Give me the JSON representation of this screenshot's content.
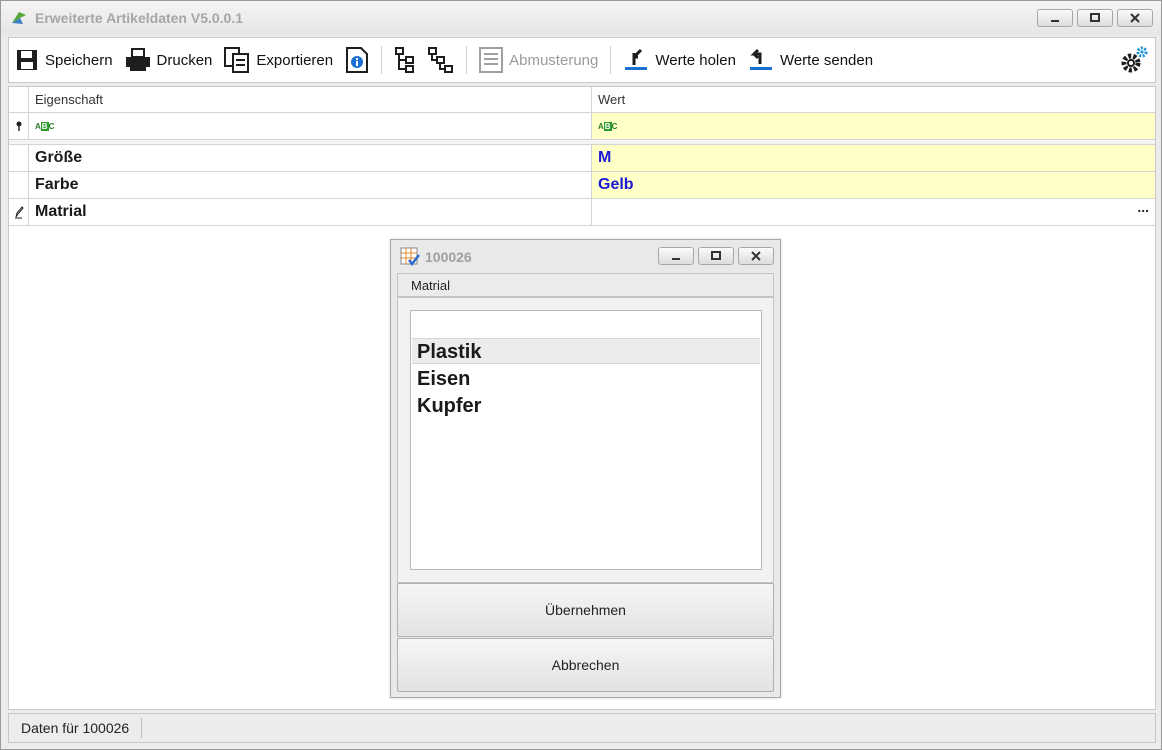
{
  "window": {
    "title": "Erweiterte Artikeldaten V5.0.0.1"
  },
  "toolbar": {
    "save_label": "Speichern",
    "print_label": "Drucken",
    "export_label": "Exportieren",
    "sampling_label": "Abmusterung",
    "fetch_label": "Werte holen",
    "send_label": "Werte senden"
  },
  "grid": {
    "columns": {
      "property": "Eigenschaft",
      "value": "Wert"
    },
    "filter_icon": "abc-filter-icon",
    "rows": [
      {
        "property": "Größe",
        "value": "M"
      },
      {
        "property": "Farbe",
        "value": "Gelb"
      },
      {
        "property": "Matrial",
        "value": "",
        "ellipsis": "..."
      }
    ]
  },
  "dialog": {
    "title": "100026",
    "field_label": "Matrial",
    "items": [
      "Plastik",
      "Eisen",
      "Kupfer"
    ],
    "selected_index": 0,
    "apply_label": "Übernehmen",
    "cancel_label": "Abbrechen"
  },
  "status": {
    "text": "Daten für 100026"
  },
  "colors": {
    "highlight_bg": "#ffffc8",
    "value_text": "#1a1ad6"
  }
}
